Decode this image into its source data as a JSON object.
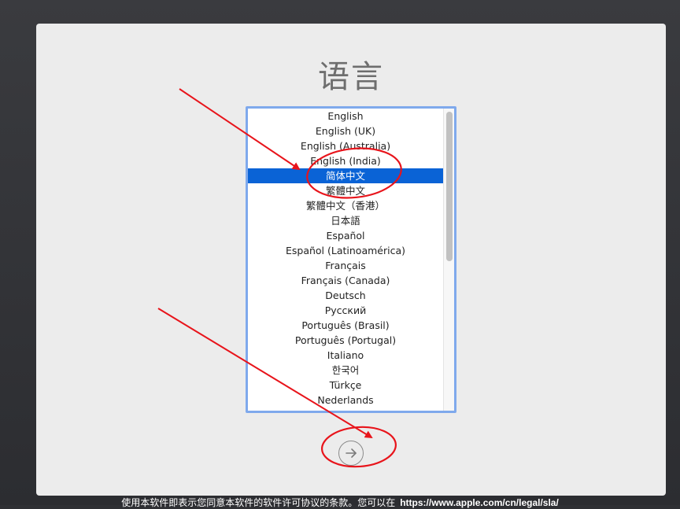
{
  "title": "语言",
  "languages": [
    "English",
    "English (UK)",
    "English (Australia)",
    "English (India)",
    "简体中文",
    "繁體中文",
    "繁體中文（香港）",
    "日本語",
    "Español",
    "Español (Latinoamérica)",
    "Français",
    "Français (Canada)",
    "Deutsch",
    "Русский",
    "Português (Brasil)",
    "Português (Portugal)",
    "Italiano",
    "한국어",
    "Türkçe",
    "Nederlands"
  ],
  "selected_index": 4,
  "next_icon": "arrow-right-circle-icon",
  "footer": {
    "text": "使用本软件即表示您同意本软件的软件许可协议的条款。您可以在",
    "link": "https://www.apple.com/cn/legal/sla/"
  },
  "colors": {
    "selection": "#0a63d6",
    "annotation": "#e8141b",
    "list_border": "#7fa9ec"
  }
}
